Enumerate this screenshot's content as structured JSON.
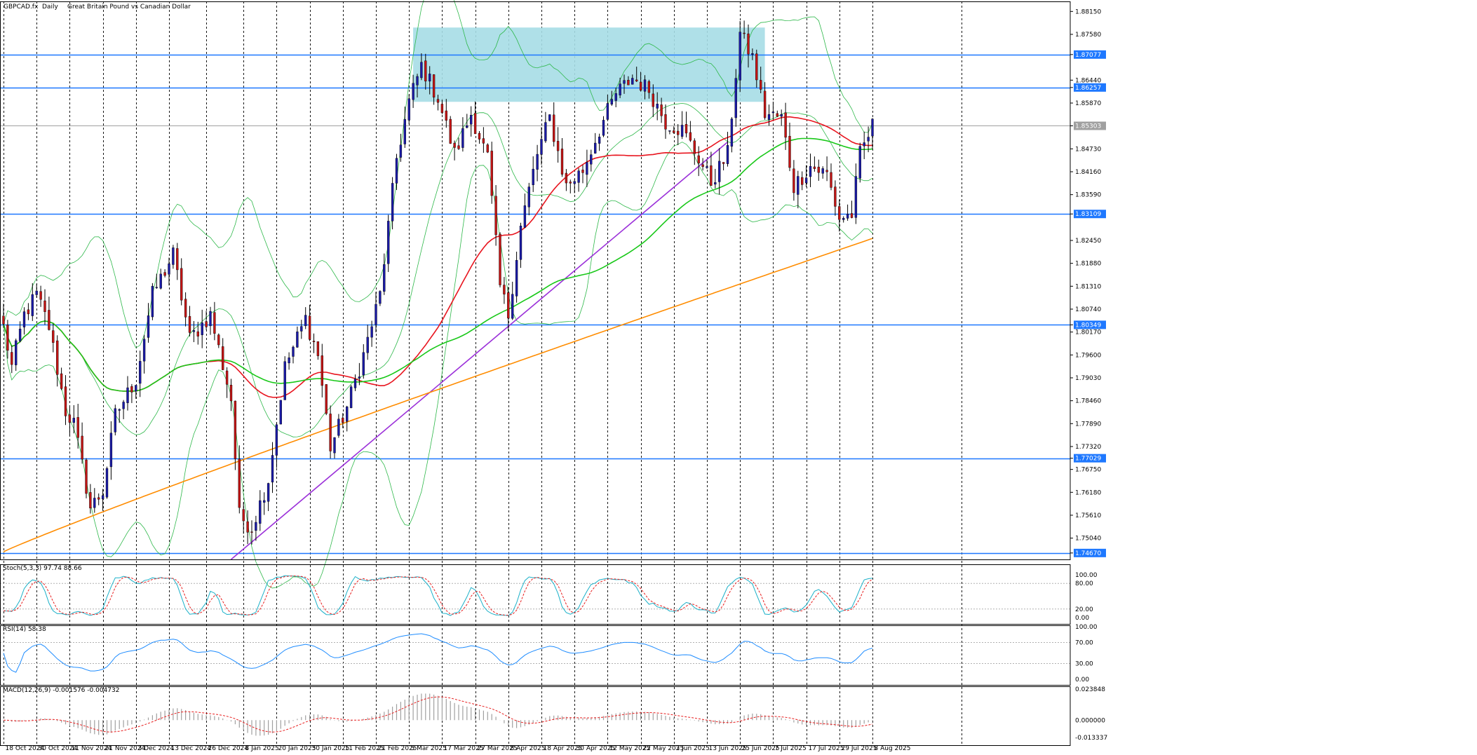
{
  "header": {
    "symbol": "GBPCAD.fx",
    "timeframe": "Daily",
    "description": "Great Britain Pound vs Canadian Dollar"
  },
  "colors": {
    "background": "#ffffff",
    "grid": "#000000",
    "bull": "#1a1aa6",
    "bear": "#c41414",
    "sma_fast": "#e8141e",
    "sma_mid": "#19c819",
    "sma_slow": "#ff8c00",
    "bollinger": "#2eb84a",
    "hline": "#1e78ff",
    "trendline": "#9b30d9",
    "zone": "#a6dde6",
    "stoch_main": "#1ab0c8",
    "stoch_signal": "#e81e1e",
    "rsi": "#1e8cff",
    "macd_hist": "#a0a0a0",
    "macd_signal": "#e81e1e"
  },
  "price_axis": {
    "labels": [
      "1.88150",
      "1.87580",
      "1.87077",
      "1.86440",
      "1.86257",
      "1.85870",
      "1.85303",
      "1.84730",
      "1.84160",
      "1.83590",
      "1.83109",
      "1.82450",
      "1.81880",
      "1.81310",
      "1.80740",
      "1.80349",
      "1.80170",
      "1.79600",
      "1.79030",
      "1.78460",
      "1.77890",
      "1.77320",
      "1.77029",
      "1.76750",
      "1.76180",
      "1.75610",
      "1.75040",
      "1.74670"
    ]
  },
  "horizontal_lines": [
    {
      "level": "1.87077"
    },
    {
      "level": "1.86257"
    },
    {
      "level": "1.83109"
    },
    {
      "level": "1.80349"
    },
    {
      "level": "1.77029"
    },
    {
      "level": "1.74670"
    }
  ],
  "current_price": "1.85303",
  "date_axis": {
    "labels": [
      "18 Oct 2024",
      "30 Oct 2024",
      "11 Nov 2024",
      "21 Nov 2024",
      "3 Dec 2024",
      "13 Dec 2024",
      "26 Dec 2024",
      "8 Jan 2025",
      "20 Jan 2025",
      "30 Jan 2025",
      "11 Feb 2025",
      "21 Feb 2025",
      "5 Mar 2025",
      "17 Mar 2025",
      "27 Mar 2025",
      "8 Apr 2025",
      "18 Apr 2025",
      "30 Apr 2025",
      "12 May 2025",
      "22 May 2025",
      "3 Jun 2025",
      "13 Jun 2025",
      "25 Jun 2025",
      "7 Jul 2025",
      "17 Jul 2025",
      "29 Jul 2025",
      "8 Aug 2025"
    ]
  },
  "stoch": {
    "label": "Stoch(5,3,3) 97.74 88.66",
    "levels": [
      "100.00",
      "80.00",
      "20.00",
      "0.00"
    ]
  },
  "rsi": {
    "label": "RSI(14) 58.38",
    "levels": [
      "100.00",
      "70.00",
      "30.00",
      "0.00"
    ]
  },
  "macd": {
    "label": "MACD(12,26,9) -0.001576 -0.004732",
    "levels": [
      "0.023848",
      "0.000000",
      "-0.013337"
    ]
  },
  "chart_data": {
    "type": "candlestick",
    "title": "GBPCAD.fx, Daily: Great Britain Pound vs Canadian Dollar",
    "ylim": [
      1.7451,
      1.884
    ],
    "x_range": [
      "18 Oct 2024",
      "8 Aug 2025"
    ],
    "grid": true,
    "close_path": [
      [
        "18 Oct 2024",
        1.803
      ],
      [
        "22 Oct 2024",
        1.793
      ],
      [
        "25 Oct 2024",
        1.806
      ],
      [
        "30 Oct 2024",
        1.811
      ],
      [
        "4 Nov 2024",
        1.803
      ],
      [
        "8 Nov 2024",
        1.782
      ],
      [
        "12 Nov 2024",
        1.779
      ],
      [
        "18 Nov 2024",
        1.758
      ],
      [
        "21 Nov 2024",
        1.762
      ],
      [
        "26 Nov 2024",
        1.781
      ],
      [
        "3 Dec 2024",
        1.79
      ],
      [
        "9 Dec 2024",
        1.811
      ],
      [
        "16 Dec 2024",
        1.821
      ],
      [
        "20 Dec 2024",
        1.8
      ],
      [
        "27 Dec 2024",
        1.806
      ],
      [
        "3 Jan 2025",
        1.785
      ],
      [
        "7 Jan 2025",
        1.756
      ],
      [
        "10 Jan 2025",
        1.753
      ],
      [
        "16 Jan 2025",
        1.765
      ],
      [
        "22 Jan 2025",
        1.793
      ],
      [
        "29 Jan 2025",
        1.805
      ],
      [
        "3 Feb 2025",
        1.796
      ],
      [
        "6 Feb 2025",
        1.773
      ],
      [
        "12 Feb 2025",
        1.783
      ],
      [
        "18 Feb 2025",
        1.796
      ],
      [
        "24 Feb 2025",
        1.811
      ],
      [
        "28 Feb 2025",
        1.845
      ],
      [
        "5 Mar 2025",
        1.859
      ],
      [
        "10 Mar 2025",
        1.868
      ],
      [
        "14 Mar 2025",
        1.86
      ],
      [
        "20 Mar 2025",
        1.846
      ],
      [
        "26 Mar 2025",
        1.856
      ],
      [
        "1 Apr 2025",
        1.845
      ],
      [
        "4 Apr 2025",
        1.813
      ],
      [
        "8 Apr 2025",
        1.806
      ],
      [
        "11 Apr 2025",
        1.828
      ],
      [
        "17 Apr 2025",
        1.846
      ],
      [
        "22 Apr 2025",
        1.855
      ],
      [
        "28 Apr 2025",
        1.838
      ],
      [
        "2 May 2025",
        1.842
      ],
      [
        "8 May 2025",
        1.852
      ],
      [
        "14 May 2025",
        1.861
      ],
      [
        "20 May 2025",
        1.865
      ],
      [
        "26 May 2025",
        1.862
      ],
      [
        "30 May 2025",
        1.854
      ],
      [
        "5 Jun 2025",
        1.852
      ],
      [
        "11 Jun 2025",
        1.845
      ],
      [
        "16 Jun 2025",
        1.839
      ],
      [
        "20 Jun 2025",
        1.846
      ],
      [
        "25 Jun 2025",
        1.876
      ],
      [
        "30 Jun 2025",
        1.87
      ],
      [
        "3 Jul 2025",
        1.856
      ],
      [
        "9 Jul 2025",
        1.855
      ],
      [
        "14 Jul 2025",
        1.838
      ],
      [
        "18 Jul 2025",
        1.843
      ],
      [
        "24 Jul 2025",
        1.841
      ],
      [
        "29 Jul 2025",
        1.83
      ],
      [
        "1 Aug 2025",
        1.831
      ],
      [
        "5 Aug 2025",
        1.846
      ],
      [
        "8 Aug 2025",
        1.853
      ]
    ]
  }
}
